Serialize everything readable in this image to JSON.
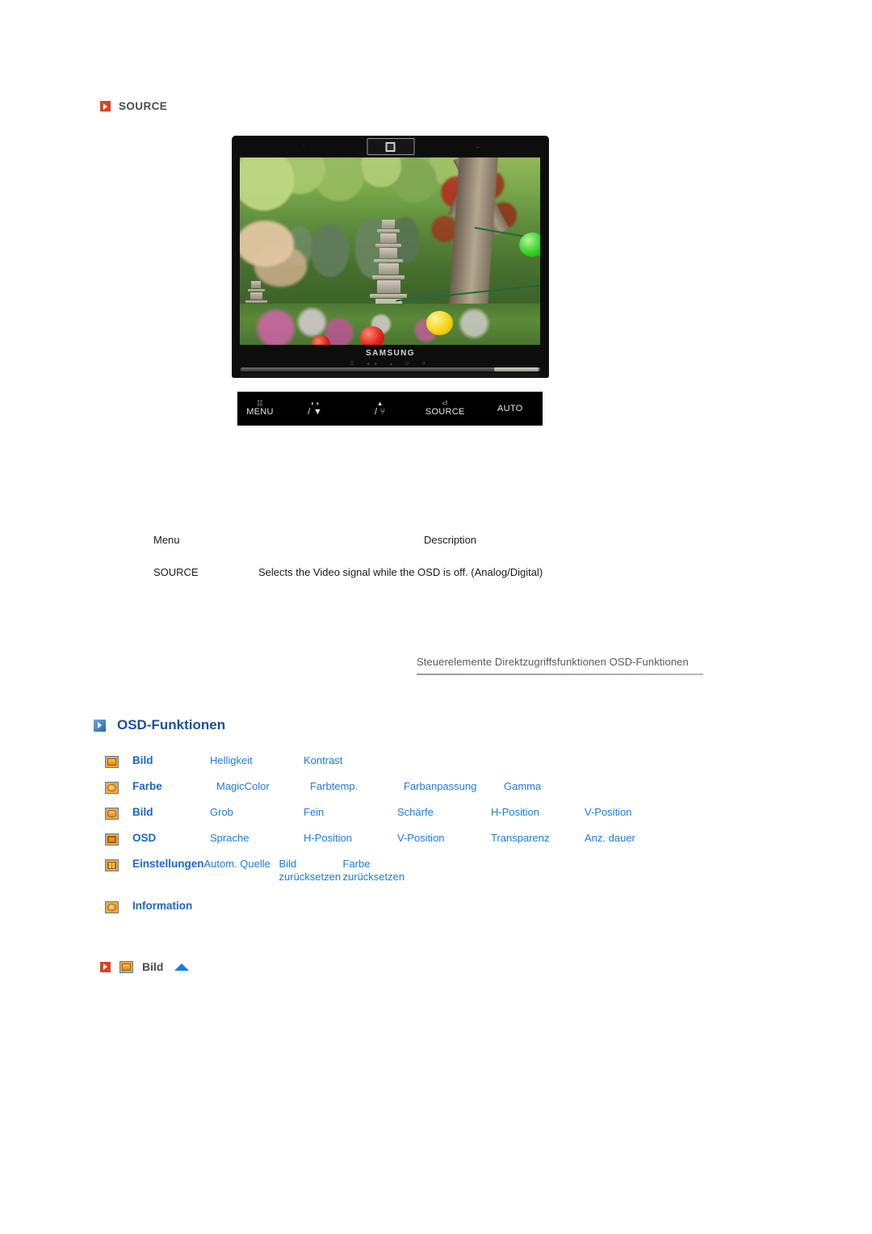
{
  "source_section": {
    "heading": "SOURCE",
    "bullet_icon": "orange-play-bullet-icon"
  },
  "monitor": {
    "brand": "SAMSUNG",
    "front_glyphs": "☰  ◂▸  ▴  ⏻  ↺",
    "top_left_mark": "∶",
    "top_right_mark": "⌐",
    "screen_description": "Photograph of a Korean temple garden with a stone pagoda, green and red foliage, and colored paper lanterns"
  },
  "control_bar": {
    "buttons": [
      {
        "glyph": "☷",
        "label": "MENU"
      },
      {
        "glyph": "◐◑",
        "label": "/ ▼"
      },
      {
        "glyph": "▲",
        "label": "/ ⑂"
      },
      {
        "glyph": "⏎",
        "label": "SOURCE"
      },
      {
        "glyph": "",
        "label": "AUTO"
      }
    ]
  },
  "desc_table": {
    "headers": {
      "menu": "Menu",
      "description": "Description"
    },
    "rows": [
      {
        "menu": "SOURCE",
        "description": "Selects the Video signal while the OSD is off. (Analog/Digital)"
      }
    ]
  },
  "breadcrumb": {
    "text": "Steuerelemente  Direktzugriffsfunktionen  OSD-Funktionen"
  },
  "osd_section": {
    "heading": "OSD-Funktionen",
    "bullet_icon": "blue-play-bullet-icon",
    "rows": [
      {
        "icon": "picture-icon",
        "name": "Bild",
        "items": [
          "Helligkeit",
          "Kontrast"
        ]
      },
      {
        "icon": "color-icon",
        "name": "Farbe",
        "items": [
          "MagicColor",
          "Farbtemp.",
          "Farbanpassung",
          "Gamma"
        ]
      },
      {
        "icon": "image-geometry-icon",
        "name": "Bild",
        "items": [
          "Grob",
          "Fein",
          "Schärfe",
          "H-Position",
          "V-Position"
        ]
      },
      {
        "icon": "osd-icon",
        "name": "OSD",
        "items": [
          "Sprache",
          "H-Position",
          "V-Position",
          "Transparenz",
          "Anz. dauer"
        ]
      },
      {
        "icon": "settings-icon",
        "name": "Einstellungen",
        "items": [
          "Autom. Quelle",
          "Bild zurücksetzen",
          "Farbe zurücksetzen"
        ]
      },
      {
        "icon": "information-icon",
        "name": "Information",
        "items": []
      }
    ]
  },
  "bild_section": {
    "label": "Bild",
    "bullet_icon": "orange-play-bullet-icon",
    "menu_icon": "picture-icon",
    "up_arrow_icon": "blue-up-arrow-icon"
  },
  "colors": {
    "orange_bullet": "#d9441f",
    "blue_bullet": "#2a64ad",
    "heading_gray": "#4d4d4d",
    "osd_heading_blue": "#1d4f9c",
    "osd_name_blue": "#1a66cc",
    "osd_item_blue": "#1a7ae8",
    "monitor_black": "#0d0d0d"
  }
}
